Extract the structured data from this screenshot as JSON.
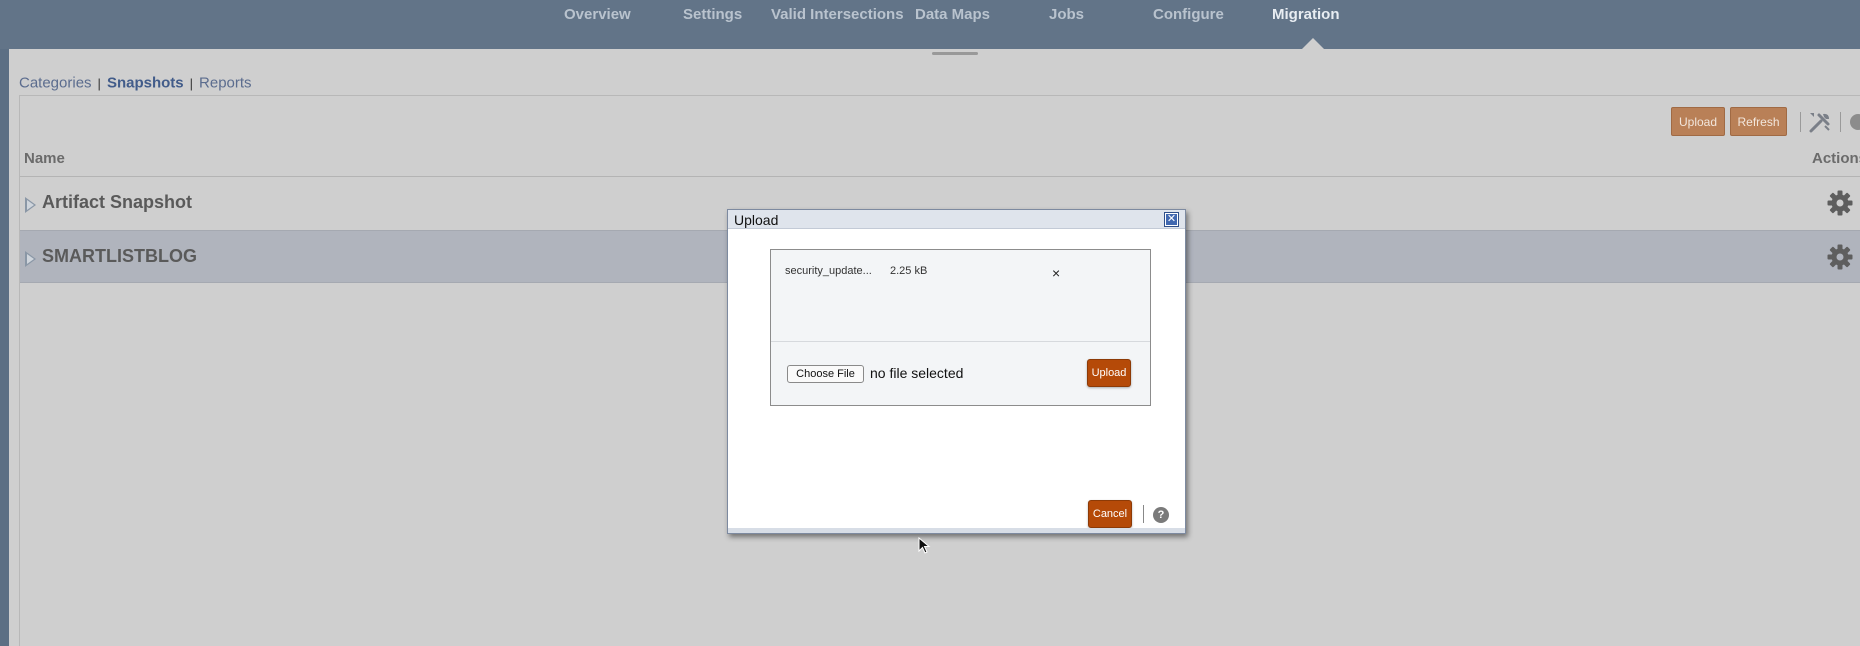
{
  "top_nav": {
    "tabs": [
      {
        "label": "Overview"
      },
      {
        "label": "Settings"
      },
      {
        "label": "Valid Intersections"
      },
      {
        "label": "Data Maps"
      },
      {
        "label": "Jobs"
      },
      {
        "label": "Configure"
      },
      {
        "label": "Migration"
      }
    ],
    "active_tab": "Migration"
  },
  "sub_nav": {
    "items": [
      "Categories",
      "Snapshots",
      "Reports"
    ],
    "active": "Snapshots",
    "separator": "|"
  },
  "toolbar": {
    "upload_label": "Upload",
    "refresh_label": "Refresh",
    "tools_icon": "tools-icon",
    "help_icon": "help-icon"
  },
  "table": {
    "columns": [
      "Name",
      "Actions"
    ],
    "rows": [
      {
        "name": "Artifact Snapshot",
        "action_icon": "gear-icon"
      },
      {
        "name": "SMARTLISTBLOG",
        "action_icon": "gear-icon"
      }
    ]
  },
  "upload_dialog": {
    "title": "Upload",
    "close_icon": "close-icon",
    "file": {
      "name": "security_update...",
      "size": "2.25 kB",
      "remove_label": "×"
    },
    "choose_file_label": "Choose File",
    "no_file_text": "no file selected",
    "upload_label": "Upload",
    "cancel_label": "Cancel",
    "help_label": "?"
  },
  "colors": {
    "nav_bg": "#627488",
    "content_bg": "#cfcfcf",
    "accent_button": "#b54a08",
    "toolbar_button": "#b98057",
    "selected_row": "#b0b4bd"
  }
}
